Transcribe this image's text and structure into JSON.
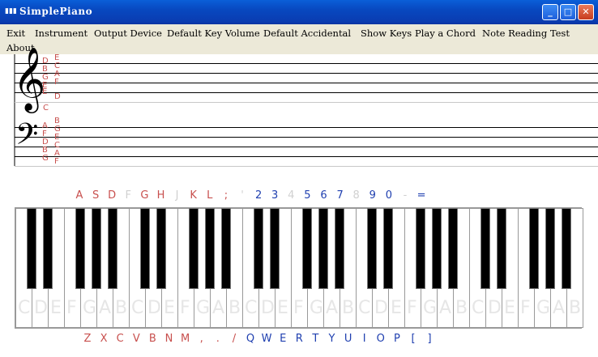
{
  "window": {
    "title": "SimplePiano"
  },
  "titlebar_buttons": {
    "minimize": "_",
    "maximize": "□",
    "close": "✕"
  },
  "menu": [
    {
      "label": "Exit"
    },
    {
      "label": "Instrument"
    },
    {
      "label": "Output Device"
    },
    {
      "label": "Default Key Volume"
    },
    {
      "label": "Default Accidental"
    },
    {
      "label": "Show Keys"
    },
    {
      "label": "Play a Chord"
    },
    {
      "label": "Note Reading Test"
    },
    {
      "label": "About"
    }
  ],
  "staff": {
    "treble_left": "DBGE",
    "treble_right": "ECAF",
    "treble_extra": [
      "D",
      "E",
      "C",
      "D"
    ],
    "bass_left": "AFDBG",
    "bass_right": "BGECAF"
  },
  "keyboard": {
    "upper_labels": [
      {
        "t": "A",
        "c": "#C8504E"
      },
      {
        "t": "S",
        "c": "#C8504E"
      },
      {
        "t": "D",
        "c": "#C8504E"
      },
      {
        "t": "F",
        "c": "#D0D0D0"
      },
      {
        "t": "G",
        "c": "#C8504E"
      },
      {
        "t": "H",
        "c": "#C8504E"
      },
      {
        "t": "J",
        "c": "#D0D0D0"
      },
      {
        "t": "K",
        "c": "#C8504E"
      },
      {
        "t": "L",
        "c": "#C8504E"
      },
      {
        "t": ";",
        "c": "#C8504E"
      },
      {
        "t": "'",
        "c": "#D0D0D0"
      },
      {
        "t": "2",
        "c": "#2040B0"
      },
      {
        "t": "3",
        "c": "#2040B0"
      },
      {
        "t": "4",
        "c": "#D0D0D0"
      },
      {
        "t": "5",
        "c": "#2040B0"
      },
      {
        "t": "6",
        "c": "#2040B0"
      },
      {
        "t": "7",
        "c": "#2040B0"
      },
      {
        "t": "8",
        "c": "#D0D0D0"
      },
      {
        "t": "9",
        "c": "#2040B0"
      },
      {
        "t": "0",
        "c": "#2040B0"
      },
      {
        "t": "-",
        "c": "#D0D0D0"
      },
      {
        "t": "=",
        "c": "#2040B0"
      }
    ],
    "lower_labels": [
      {
        "t": "Z",
        "c": "#C8504E"
      },
      {
        "t": "X",
        "c": "#C8504E"
      },
      {
        "t": "C",
        "c": "#C8504E"
      },
      {
        "t": "V",
        "c": "#C8504E"
      },
      {
        "t": "B",
        "c": "#C8504E"
      },
      {
        "t": "N",
        "c": "#C8504E"
      },
      {
        "t": "M",
        "c": "#C8504E"
      },
      {
        "t": ",",
        "c": "#C8504E"
      },
      {
        "t": ".",
        "c": "#C8504E"
      },
      {
        "t": "/",
        "c": "#C8504E"
      },
      {
        "t": "Q",
        "c": "#2040B0"
      },
      {
        "t": "W",
        "c": "#2040B0"
      },
      {
        "t": "E",
        "c": "#2040B0"
      },
      {
        "t": "R",
        "c": "#2040B0"
      },
      {
        "t": "T",
        "c": "#2040B0"
      },
      {
        "t": "Y",
        "c": "#2040B0"
      },
      {
        "t": "U",
        "c": "#2040B0"
      },
      {
        "t": "I",
        "c": "#2040B0"
      },
      {
        "t": "O",
        "c": "#2040B0"
      },
      {
        "t": "P",
        "c": "#2040B0"
      },
      {
        "t": "[",
        "c": "#2040B0"
      },
      {
        "t": "]",
        "c": "#2040B0"
      }
    ],
    "white_notes": [
      "C",
      "D",
      "E",
      "F",
      "G",
      "A",
      "B",
      "C",
      "D",
      "E",
      "F",
      "G",
      "A",
      "B",
      "C",
      "D",
      "E",
      "F",
      "G",
      "A",
      "B",
      "C",
      "D",
      "E",
      "F",
      "G",
      "A",
      "B",
      "C",
      "D",
      "E",
      "F",
      "G",
      "A",
      "B"
    ]
  }
}
